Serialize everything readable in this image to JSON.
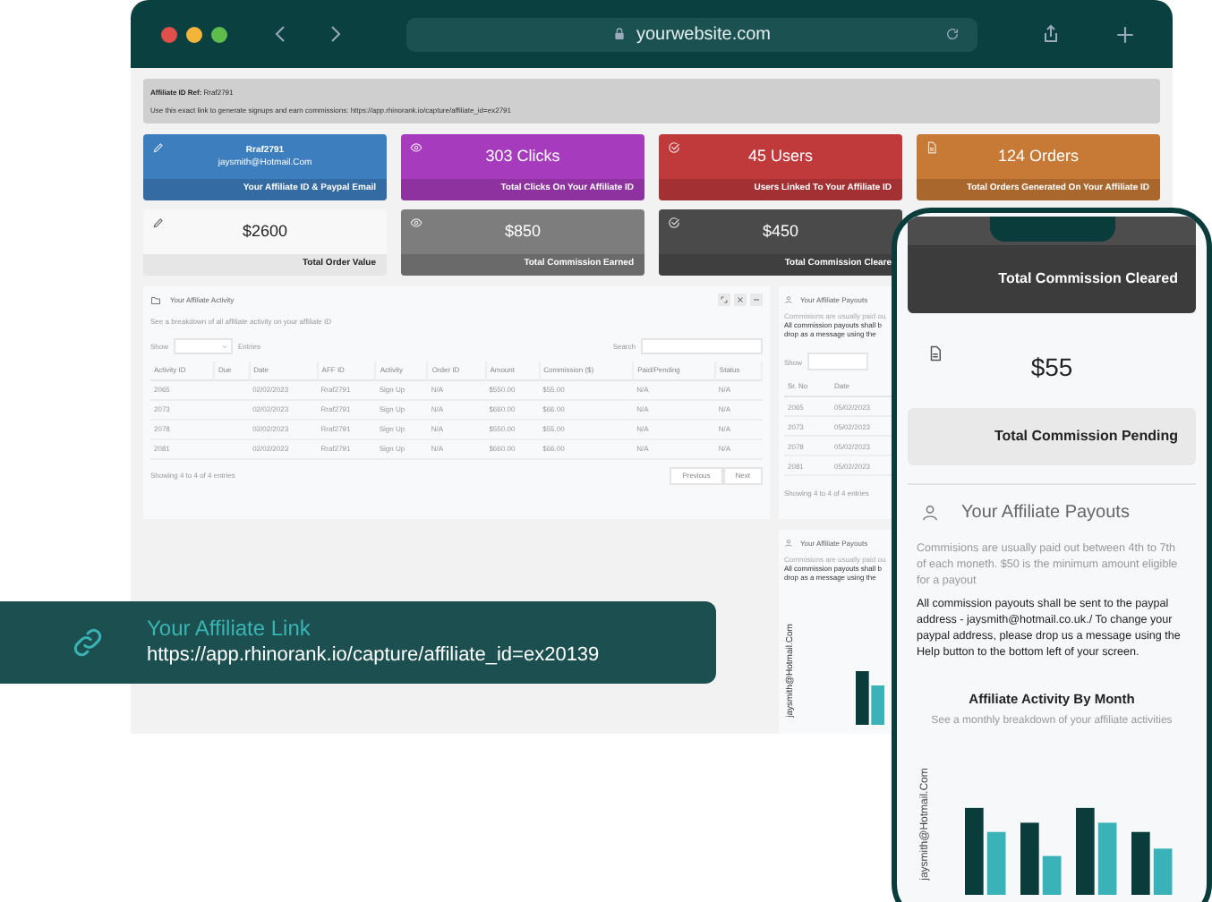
{
  "browser": {
    "url": "yourwebsite.com"
  },
  "info_bar": {
    "label": "Affiliate ID Ref:",
    "value": "Rraf2791",
    "text": "Use this exact link to generate signups and earn commissions: https://app.rhinorank.io/capture/affiliate_id=ex2791"
  },
  "cards": [
    {
      "kind": "filled",
      "color": "#3d7ebf",
      "value": "Rraf2791",
      "detail": "jaysmith@Hotmail.Com",
      "label": "Your Affiliate ID & Paypal Email"
    },
    {
      "kind": "filled",
      "color": "#a73bbd",
      "value": "303 Clicks",
      "label": "Total Clicks On Your Affiliate ID"
    },
    {
      "kind": "filled",
      "color": "#c0393b",
      "value": "45 Users",
      "label": "Users Linked To Your Affiliate ID"
    },
    {
      "kind": "filled",
      "color": "#c77a36",
      "value": "124 Orders",
      "label": "Total Orders Generated On Your Affiliate ID"
    },
    {
      "kind": "light",
      "color": "#f8f8f9",
      "value": "$2600",
      "label": "Total Order Value"
    },
    {
      "kind": "filled",
      "color": "#7d7d7d",
      "value": "$850",
      "label": "Total Commission Earned"
    },
    {
      "kind": "filled",
      "color": "#4a4a4a",
      "value": "$450",
      "label": "Total Commission Cleare"
    }
  ],
  "activity": {
    "title": "Your Affiliate Activity",
    "subtitle": "See a breakdown of all affiliate activity on your affiliate ID",
    "show": "Show",
    "entries": "Entries",
    "search": "Search",
    "columns": [
      "Activity ID",
      "Due",
      "Date",
      "AFF ID",
      "Activity",
      "Order ID",
      "Amount",
      "Commission ($)",
      "Paid/Pending",
      "Status"
    ],
    "rows": [
      [
        "2065",
        "",
        "02/02/2023",
        "Rraf2791",
        "Sign Up",
        "N/A",
        "$550.00",
        "$55.00",
        "N/A",
        "N/A"
      ],
      [
        "2073",
        "",
        "02/02/2023",
        "Rraf2791",
        "Sign Up",
        "N/A",
        "$660.00",
        "$66.00",
        "N/A",
        "N/A"
      ],
      [
        "2078",
        "",
        "02/02/2023",
        "Rraf2791",
        "Sign Up",
        "N/A",
        "$550.00",
        "$55.00",
        "N/A",
        "N/A"
      ],
      [
        "2081",
        "",
        "02/02/2023",
        "Rraf2791",
        "Sign Up",
        "N/A",
        "$660.00",
        "$66.00",
        "N/A",
        "N/A"
      ]
    ],
    "footer": "Showing 4 to 4 of 4 entries",
    "buttons": [
      "Previous",
      "Next"
    ]
  },
  "side_payouts": {
    "title": "Your Affiliate Payouts",
    "lines": [
      "Commisions are usually paid ou",
      "All commission payouts shall b",
      "drop as a message using the"
    ],
    "show": "Show",
    "columns": [
      "Sr. No",
      "Date"
    ],
    "rows": [
      [
        "2065",
        "05/02/2023"
      ],
      [
        "2073",
        "05/02/2023"
      ],
      [
        "2078",
        "05/02/2023"
      ],
      [
        "2081",
        "05/02/2023"
      ]
    ],
    "footer": "Showing 4 to 4 of 4 entries"
  },
  "side_chart": {
    "title": "Your Affiliate Payouts",
    "lines": [
      "Commisions are usually paid ou",
      "All commission payouts shall b",
      "drop as a message using the"
    ],
    "axis_label": "jaysmith@Hotmail.Com"
  },
  "link": {
    "title": "Your Affiliate Link",
    "url": "https://app.rhinorank.io/capture/affiliate_id=ex20139"
  },
  "phone": {
    "cleared_label": "Total Commission Cleared",
    "pending_value": "$55",
    "pending_label": "Total Commission Pending",
    "payouts_title": "Your Affiliate Payouts",
    "note": "Commisions are usually paid out between 4th to 7th of each moneth. $50 is the minimum amount eligible for a payout",
    "paypal_note": "All commission payouts shall be sent to the paypal address - jaysmith@hotmail.co.uk./ To change your paypal address, please drop us a message using the Help button to the bottom left of your screen.",
    "chart_title": "Affiliate Activity By Month",
    "chart_subtitle": "See a monthly breakdown of your affiliate activities",
    "axis_label": "jaysmith@Hotmail.Com"
  }
}
